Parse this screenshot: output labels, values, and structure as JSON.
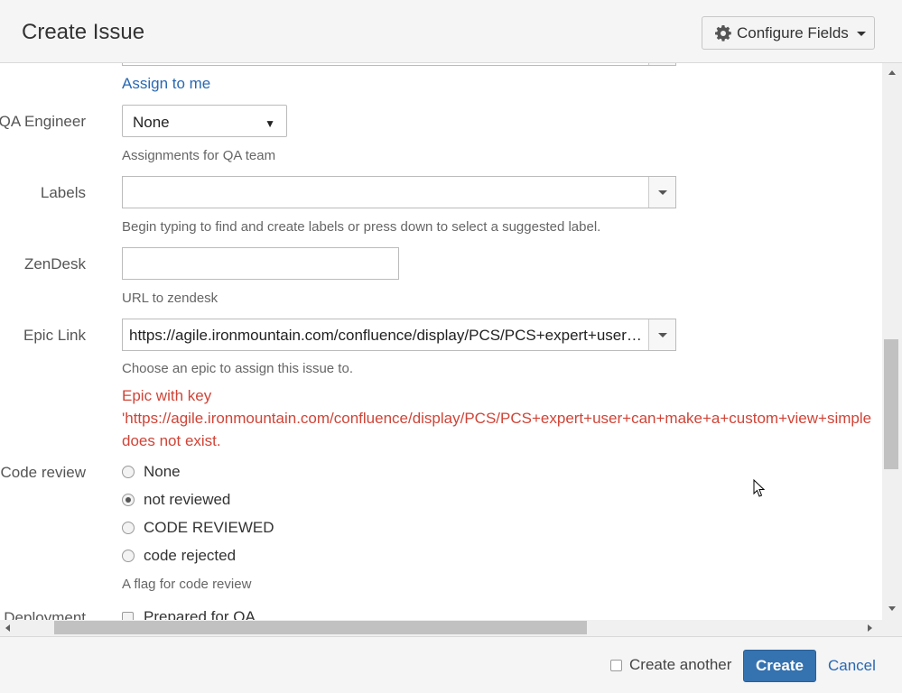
{
  "header": {
    "title": "Create Issue",
    "configure_fields_label": "Configure Fields"
  },
  "form": {
    "assign_to_me": "Assign to me",
    "qa_engineer": {
      "label": "QA Engineer",
      "value": "None",
      "description": "Assignments for QA team"
    },
    "labels": {
      "label": "Labels",
      "value": "",
      "description": "Begin typing to find and create labels or press down to select a suggested label."
    },
    "zendesk": {
      "label": "ZenDesk",
      "value": "",
      "description": "URL to zendesk"
    },
    "epic_link": {
      "label": "Epic Link",
      "value": "https://agile.ironmountain.com/confluence/display/PCS/PCS+expert+user+can+make+a+custom+view+simple",
      "description": "Choose an epic to assign this issue to.",
      "error_line1": "Epic with key",
      "error_line2": "'https://agile.ironmountain.com/confluence/display/PCS/PCS+expert+user+can+make+a+custom+view+simple",
      "error_line3": "does not exist."
    },
    "code_review": {
      "label": "Code review",
      "options": [
        {
          "label": "None",
          "checked": false
        },
        {
          "label": "not reviewed",
          "checked": true
        },
        {
          "label": "CODE REVIEWED",
          "checked": false
        },
        {
          "label": "code rejected",
          "checked": false
        }
      ],
      "description": "A flag for code review"
    },
    "deployment": {
      "label": "Deployment",
      "option": "Prepared for QA"
    }
  },
  "footer": {
    "create_another_label": "Create another",
    "create_label": "Create",
    "cancel_label": "Cancel"
  },
  "colors": {
    "primary": "#3572b0",
    "link": "#2968b2",
    "error": "#d04437"
  }
}
